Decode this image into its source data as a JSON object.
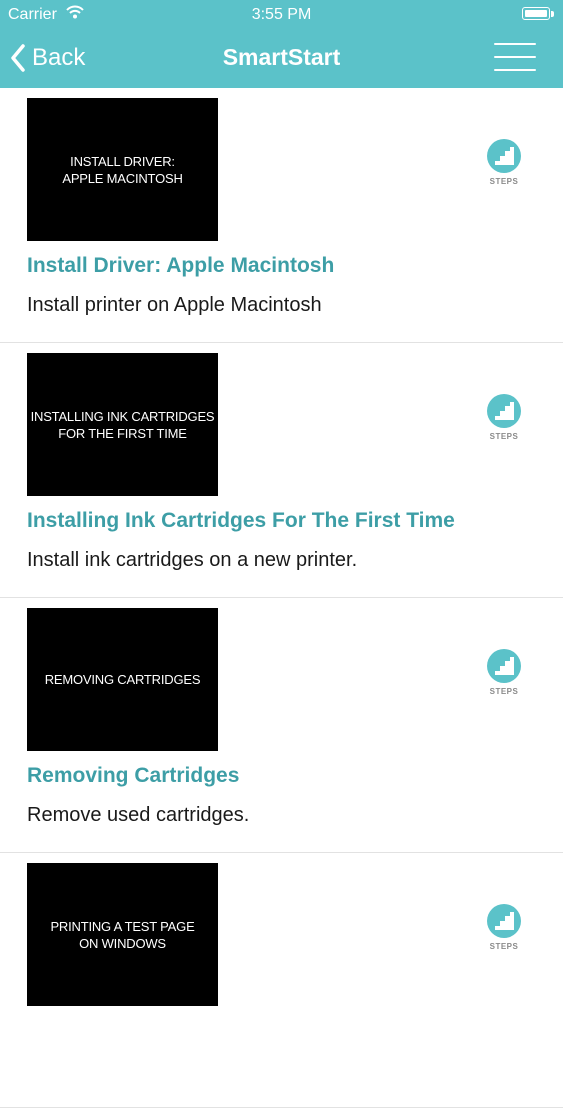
{
  "status_bar": {
    "carrier": "Carrier",
    "time": "3:55 PM"
  },
  "nav": {
    "back_label": "Back",
    "title": "SmartStart"
  },
  "colors": {
    "header": "#5bc2c9",
    "title_accent": "#3d9ea6"
  },
  "items": [
    {
      "thumbnail_text": "INSTALL DRIVER:\nAPPLE MACINTOSH",
      "title": "Install Driver: Apple Macintosh",
      "description": "Install printer on Apple Macintosh",
      "badge": "STEPS"
    },
    {
      "thumbnail_text": "INSTALLING INK CARTRIDGES\nFOR THE FIRST TIME",
      "title": "Installing Ink Cartridges For The First Time",
      "description": "Install ink cartridges on a new printer.",
      "badge": "STEPS"
    },
    {
      "thumbnail_text": "REMOVING CARTRIDGES",
      "title": "Removing Cartridges",
      "description": "Remove used cartridges.",
      "badge": "STEPS"
    },
    {
      "thumbnail_text": "PRINTING A TEST PAGE\nON WINDOWS",
      "title": "",
      "description": "",
      "badge": "STEPS"
    }
  ]
}
